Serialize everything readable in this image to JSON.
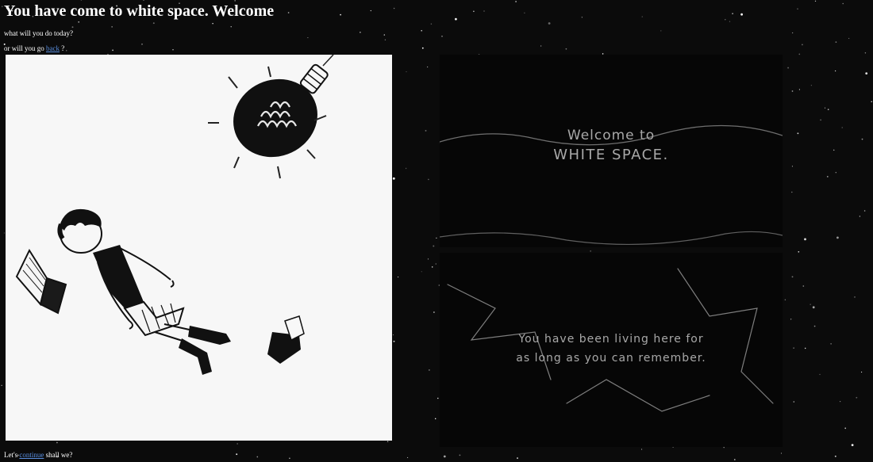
{
  "page": {
    "title": "You have come to white space. Welcome",
    "prompt": "what will you do today?",
    "back_prefix": "or will you go",
    "back_link": "back",
    "back_suffix": "?",
    "continue_prefix": "Let's",
    "continue_link": "continue",
    "continue_suffix": "shall we?"
  },
  "panels": {
    "welcome_line1": "Welcome to",
    "welcome_line2": "WHITE SPACE.",
    "memory_line1": "You have been living here for",
    "memory_line2": "as long as you can remember."
  },
  "colors": {
    "background": "#0b0b0b",
    "link": "#5a8fe0",
    "art_paper": "#f7f7f7",
    "panel": "#060606"
  },
  "icons": {
    "lightbulb": "lightbulb-drawing",
    "laptop": "laptop-drawing",
    "tissue_box": "tissue-box-drawing"
  }
}
